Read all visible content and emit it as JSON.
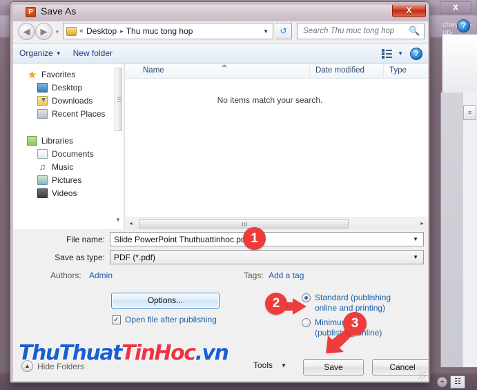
{
  "background_app": {
    "close_label": "X",
    "help_icon": "help-question-icon",
    "collapse_icon": "chevron-up-icon",
    "zoom_plus": "+",
    "fit_slide_icon": "fit-slide-icon",
    "scroll_up": "▲",
    "scroll_down": "▼",
    "scroll_prev_page": "▲",
    "scroll_next_page": "▼",
    "thumb_grip": "≡"
  },
  "dialog": {
    "title": "Save As",
    "app_icon_letter": "P",
    "close_label": "X"
  },
  "nav": {
    "back_icon": "◀",
    "forward_icon": "▶",
    "history_caret": "▼",
    "address": {
      "chevrons": "«",
      "crumbs": [
        "Desktop",
        "Thu muc tong hop"
      ],
      "separator": "▸",
      "caret": "▼"
    },
    "refresh_icon": "↻",
    "search": {
      "placeholder": "Search Thu muc tong hop",
      "value": "",
      "icon": "⚲"
    }
  },
  "commandbar": {
    "organize": "Organize",
    "organize_caret": "▼",
    "new_folder": "New folder",
    "view_caret": "▼",
    "help_label": "?"
  },
  "sidebar": {
    "groups": [
      {
        "label": "Favorites",
        "icon": "star-icon",
        "items": [
          {
            "label": "Desktop",
            "icon": "desktop-icon"
          },
          {
            "label": "Downloads",
            "icon": "downloads-icon"
          },
          {
            "label": "Recent Places",
            "icon": "recent-places-icon"
          }
        ]
      },
      {
        "label": "Libraries",
        "icon": "libraries-icon",
        "items": [
          {
            "label": "Documents",
            "icon": "documents-icon"
          },
          {
            "label": "Music",
            "icon": "music-icon"
          },
          {
            "label": "Pictures",
            "icon": "pictures-icon"
          },
          {
            "label": "Videos",
            "icon": "videos-icon"
          }
        ]
      }
    ],
    "scroll_down_icon": "▼"
  },
  "filelist": {
    "columns": [
      "Name",
      "Date modified",
      "Type"
    ],
    "empty_message": "No items match your search.",
    "hscroll_left": "◂",
    "hscroll_right": "▸"
  },
  "form": {
    "filename_label": "File name:",
    "filename_value": "Slide PowerPoint Thuthuattinhoc.pdf",
    "filename_caret": "▼",
    "savetype_label": "Save as type:",
    "savetype_value": "PDF (*.pdf)",
    "savetype_caret": "▼",
    "authors_label": "Authors:",
    "authors_value": "Admin",
    "tags_label": "Tags:",
    "tags_value": "Add a tag",
    "options_button": "Options...",
    "open_after_publishing": "Open file after publishing",
    "open_after_publishing_checked": true,
    "checkmark": "✓",
    "optimize": [
      {
        "label": "Standard (publishing online and printing)",
        "checked": true
      },
      {
        "label": "Minimum size (publishing online)",
        "checked": false
      }
    ]
  },
  "bottombar": {
    "hide_folders_label": "Hide Folders",
    "hide_folders_icon": "▲",
    "tools_label": "Tools",
    "tools_caret": "▼",
    "save_label": "Save",
    "cancel_label": "Cancel"
  },
  "annotations": {
    "markers": [
      "1",
      "2",
      "3"
    ],
    "color": "#ee3b3b"
  },
  "watermark": {
    "part1": "ThuThuat",
    "part2": "TinHoc",
    "part3": ".vn",
    "color1": "#1a5fd0",
    "color2": "#ef3340"
  }
}
